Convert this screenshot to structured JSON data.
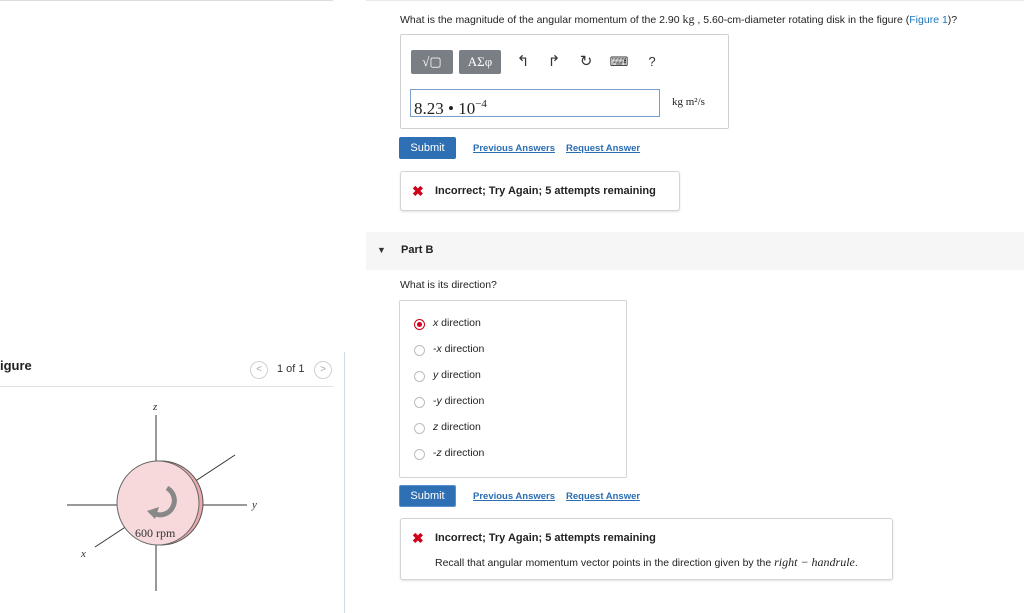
{
  "figure_panel": {
    "heading": "igure",
    "pager": {
      "prev": "<",
      "label": "1 of 1",
      "next": ">"
    },
    "diagram": {
      "axis_z": "z",
      "axis_y": "y",
      "axis_x": "x",
      "disk_label": "600 rpm"
    }
  },
  "part_a": {
    "question_pre": "What is the magnitude of the angular momentum of the 2.90 ",
    "question_unit": "kg",
    "question_post": " , 5.60-cm-diameter rotating disk in the figure (",
    "figure_link": "Figure 1",
    "question_end": ")?",
    "toolbar": {
      "template_label": "√▢",
      "greek_label": "ΑΣφ",
      "undo": "↰",
      "redo": "↱",
      "reset": "↻",
      "keyboard": "⌨",
      "help": "?"
    },
    "answer_mantissa": "8.23 • 10",
    "answer_exponent": "−4",
    "units": "kg m²/s",
    "submit_label": "Submit",
    "previous_answers_label": "Previous Answers",
    "request_answer_label": "Request Answer",
    "feedback": {
      "icon": "✖",
      "title": "Incorrect; Try Again; 5 attempts remaining"
    }
  },
  "part_b": {
    "caret": "▼",
    "title": "Part B",
    "question": "What is its direction?",
    "options": [
      {
        "sign": "",
        "axis": "x",
        "rest": " direction",
        "selected": true
      },
      {
        "sign": "-",
        "axis": "x",
        "rest": " direction",
        "selected": false
      },
      {
        "sign": "",
        "axis": "y",
        "rest": " direction",
        "selected": false
      },
      {
        "sign": "-",
        "axis": "y",
        "rest": " direction",
        "selected": false
      },
      {
        "sign": "",
        "axis": "z",
        "rest": " direction",
        "selected": false
      },
      {
        "sign": "-",
        "axis": "z",
        "rest": " direction",
        "selected": false
      }
    ],
    "submit_label": "Submit",
    "previous_answers_label": "Previous Answers",
    "request_answer_label": "Request Answer",
    "feedback": {
      "icon": "✖",
      "title": "Incorrect; Try Again; 5 attempts remaining",
      "hint_pre": "Recall that angular momentum vector points in the direction given by the ",
      "hint_math": "right − handrule",
      "hint_post": "."
    }
  },
  "colors": {
    "link": "#1a73b8",
    "submit": "#2f6fb4",
    "error": "#d0021b",
    "toolbar": "#7a7f86"
  }
}
